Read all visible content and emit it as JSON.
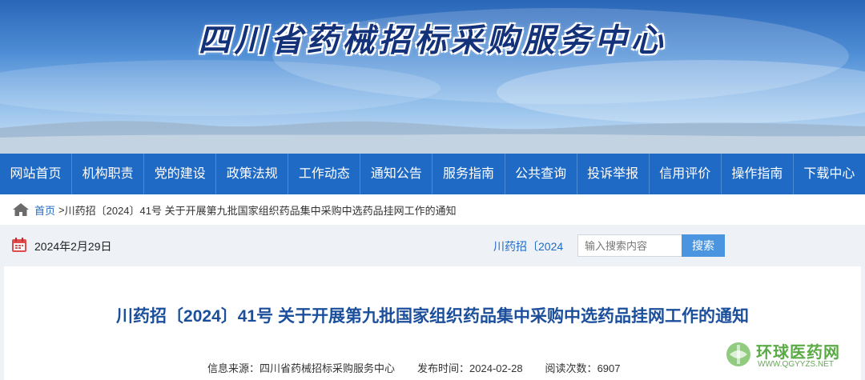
{
  "site": {
    "title": "四川省药械招标采购服务中心"
  },
  "nav": [
    "网站首页",
    "机构职责",
    "党的建设",
    "政策法规",
    "工作动态",
    "通知公告",
    "服务指南",
    "公共查询",
    "投诉举报",
    "信用评价",
    "操作指南",
    "下载中心"
  ],
  "breadcrumb": {
    "home": "首页",
    "separator": ">",
    "current": "川药招〔2024〕41号 关于开展第九批国家组织药品集中采购中选药品挂网工作的通知"
  },
  "datebar": {
    "date": "2024年2月29日",
    "search_scope": "川药招〔2024",
    "search_placeholder": "输入搜索内容",
    "search_button": "搜索"
  },
  "article": {
    "title": "川药招〔2024〕41号 关于开展第九批国家组织药品集中采购中选药品挂网工作的通知",
    "source_label": "信息来源：",
    "source": "四川省药械招标采购服务中心",
    "publish_label": "发布时间：",
    "publish_date": "2024-02-28",
    "views_label": "阅读次数：",
    "views": "6907"
  },
  "watermark": {
    "name": "环球医药网",
    "url": "WWW.QGYYZS.NET"
  },
  "colors": {
    "nav_bg": "#1f6ac4",
    "link": "#1f6ac4",
    "title": "#1b4f9c",
    "search_button": "#4b95e0"
  },
  "icons": [
    "home-icon",
    "calendar-icon",
    "watermark-logo"
  ]
}
